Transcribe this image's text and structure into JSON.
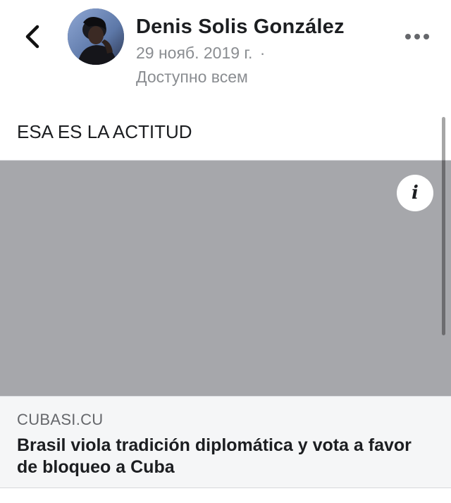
{
  "header": {
    "author_name": "Denis Solis González",
    "date": "29 нояб. 2019 г.",
    "separator": "·",
    "audience": "Доступно всем",
    "back_icon": "chevron-left-icon",
    "more_icon": "more-horizontal-icon"
  },
  "post": {
    "text": "ESA ES LA ACTITUD"
  },
  "link_preview": {
    "domain": "CUBASI.CU",
    "title": "Brasil viola tradición diplomática y vota a favor de bloqueo a Cuba",
    "info_glyph": "i",
    "placeholder_color": "#a6a7ab"
  },
  "colors": {
    "text_primary": "#1c1e21",
    "text_secondary": "#8a8d91",
    "card_footer_bg": "#f5f6f7"
  }
}
